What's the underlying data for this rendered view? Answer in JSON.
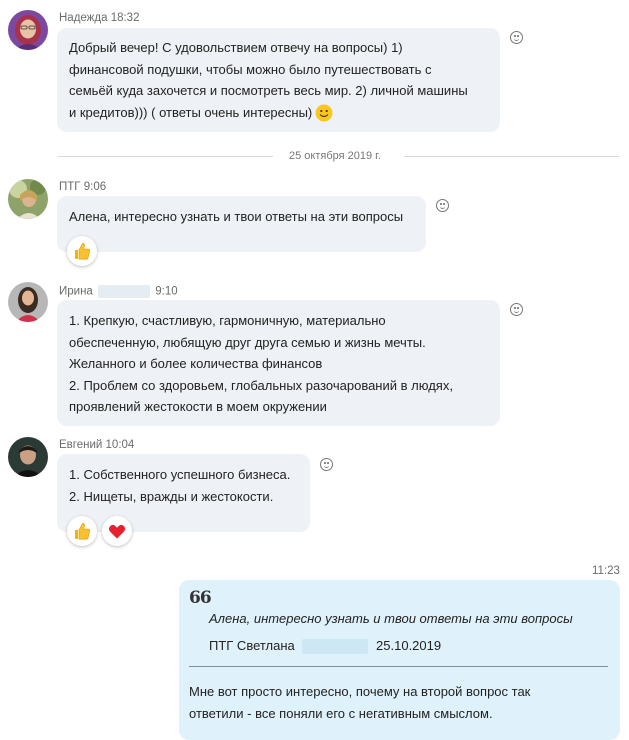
{
  "messages": [
    {
      "author": "Надежда",
      "time": "18:32",
      "lines": [
        "Добрый вечер! С удовольствием отвечу на вопросы) 1)",
        "финансовой подушки, чтобы можно было путешествовать с",
        "семьёй куда захочется и посмотреть весь мир. 2) личной машины",
        "и кредитов))) ( ответы очень интересны)"
      ]
    },
    {
      "author": "ПТГ",
      "time": "9:06",
      "lines": [
        "Алена, интересно узнать и твои ответы на эти вопросы"
      ]
    },
    {
      "author": "Ирина",
      "time": "9:10",
      "lines": [
        "1. Крепкую, счастливую, гармоничную, материально",
        "обеспеченную, любящую друг друга семью и жизнь мечты.",
        "Желанного и более количества финансов",
        "2. Проблем со здоровьем, глобальных разочарований в людях,",
        "проявлений жестокости в моем окружении"
      ]
    },
    {
      "author": "Евгений",
      "time": "10:04",
      "lines": [
        "1. Собственного успешного бизнеса.",
        "2. Нищеты, вражды и жестокости."
      ]
    }
  ],
  "date_divider": "25 октября 2019 г.",
  "outgoing": {
    "time": "11:23",
    "quote_mark": "66",
    "quote_text": "Алена, интересно узнать и твои ответы на эти вопросы",
    "quote_author": "ПТГ Светлана",
    "quote_date": "25.10.2019",
    "lines": [
      "Мне вот просто интересно, почему на второй вопрос так",
      "ответили - все поняли его с негативным смыслом."
    ]
  },
  "colors": {
    "incoming_bubble": "#eef1f5",
    "outgoing_bubble": "#dff2fb",
    "meta_text": "#6b6b6b"
  },
  "icons": {
    "reaction_add": "smiley-outline-icon",
    "emoji_smile": "smile-emoji-icon",
    "thumbs_up": "thumbs-up-emoji-icon",
    "heart": "heart-emoji-icon",
    "quote": "quote-mark-icon"
  }
}
